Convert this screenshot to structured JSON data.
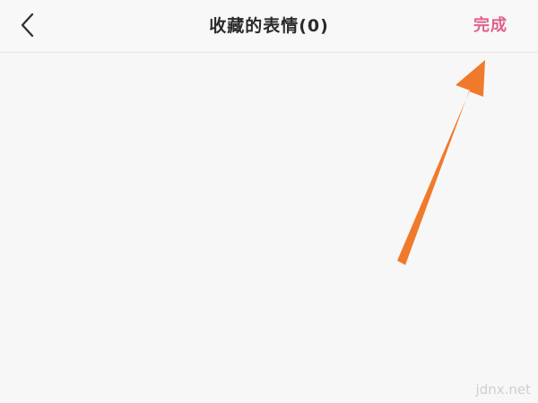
{
  "nav": {
    "back_icon": "chevron-left-icon",
    "title": "收藏的表情(0)",
    "done_label": "完成"
  },
  "colors": {
    "accent": "#e0608d",
    "arrow": "#f07a2c",
    "background": "#f7f7f7"
  },
  "watermark": "jdnx.net"
}
